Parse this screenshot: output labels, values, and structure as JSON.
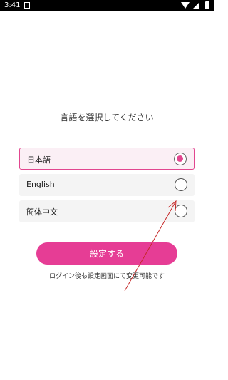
{
  "status_bar": {
    "time": "3:41"
  },
  "title": "言語を選択してください",
  "languages": [
    {
      "label": "日本語",
      "selected": true
    },
    {
      "label": "English",
      "selected": false
    },
    {
      "label": "簡体中文",
      "selected": false
    }
  ],
  "submit_label": "設定する",
  "note": "ログイン後も設定画面にて変更可能です",
  "colors": {
    "accent": "#e63d95",
    "selected_border": "#e2468f",
    "annotation_arrow": "#c62828"
  }
}
